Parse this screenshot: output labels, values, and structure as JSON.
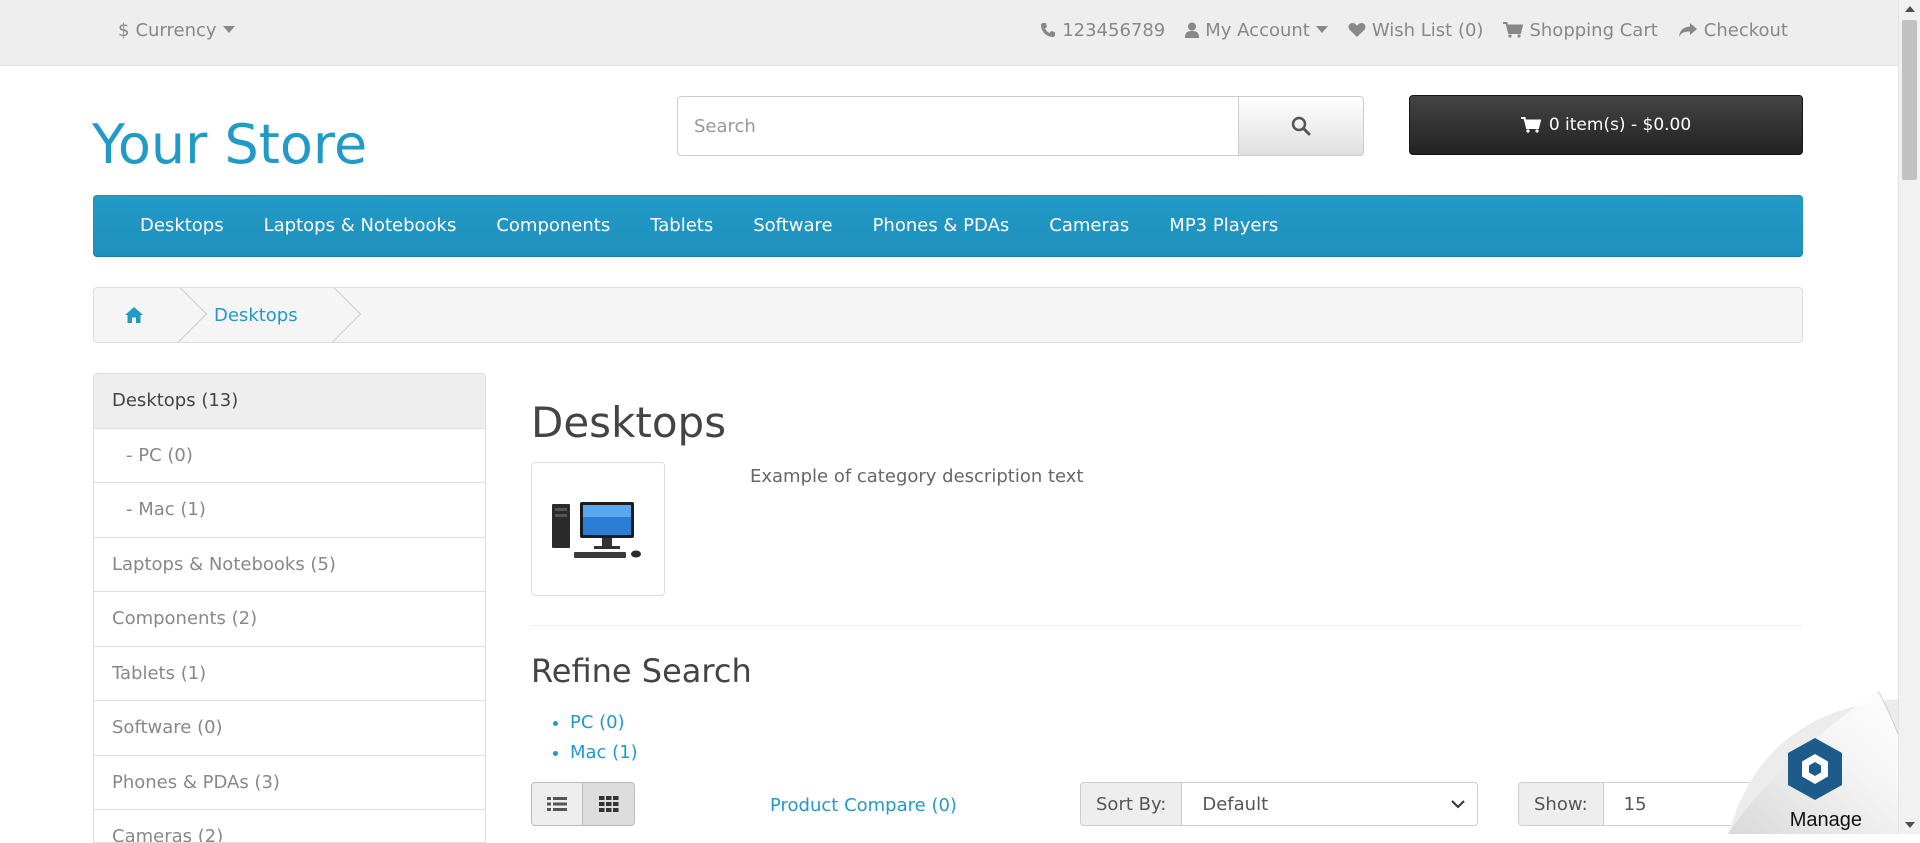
{
  "topbar": {
    "currency_label": "Currency",
    "phone": "123456789",
    "my_account": "My Account",
    "wish_list": "Wish List (0)",
    "shopping_cart": "Shopping Cart",
    "checkout": "Checkout"
  },
  "header": {
    "logo": "Your Store",
    "search_placeholder": "Search",
    "cart_summary": "0 item(s) - $0.00"
  },
  "menu": {
    "items": [
      "Desktops",
      "Laptops & Notebooks",
      "Components",
      "Tablets",
      "Software",
      "Phones & PDAs",
      "Cameras",
      "MP3 Players"
    ]
  },
  "breadcrumb": {
    "current": "Desktops"
  },
  "sidebar": {
    "items": [
      {
        "label": "Desktops (13)"
      },
      {
        "label": "- PC (0)"
      },
      {
        "label": "- Mac (1)"
      },
      {
        "label": "Laptops & Notebooks (5)"
      },
      {
        "label": "Components (2)"
      },
      {
        "label": "Tablets (1)"
      },
      {
        "label": "Software (0)"
      },
      {
        "label": "Phones & PDAs (3)"
      },
      {
        "label": "Cameras (2)"
      }
    ]
  },
  "main": {
    "title": "Desktops",
    "description": "Example of category description text",
    "refine_title": "Refine Search",
    "refine_items": [
      "PC (0)",
      "Mac (1)"
    ],
    "product_compare": "Product Compare (0)",
    "sort_label": "Sort By:",
    "sort_value": "Default",
    "show_label": "Show:",
    "show_value": "15"
  },
  "badge": {
    "label": "Manage"
  },
  "colors": {
    "brand": "#229ac8",
    "cart_button": "#333333"
  }
}
